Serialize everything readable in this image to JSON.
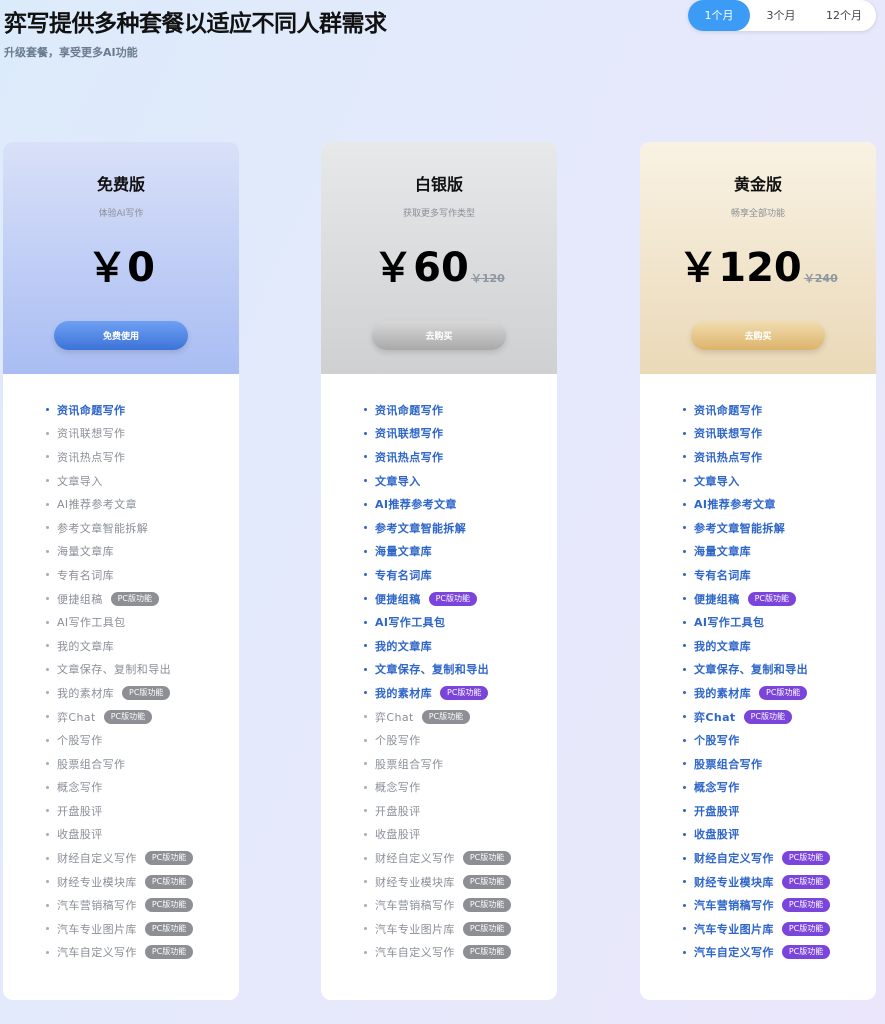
{
  "header": {
    "title": "弈写提供多种套餐以适应不同人群需求",
    "subtitle": "升级套餐，享受更多AI功能"
  },
  "period_tabs": [
    {
      "label": "1个月",
      "active": true
    },
    {
      "label": "3个月",
      "active": false
    },
    {
      "label": "12个月",
      "active": false
    }
  ],
  "badge_label": "PC版功能",
  "plans": [
    {
      "name": "免费版",
      "desc": "体验AI写作",
      "price": "￥0",
      "old_price": "",
      "button": "免费使用"
    },
    {
      "name": "白银版",
      "desc": "获取更多写作类型",
      "price": "￥60",
      "old_price": "￥120",
      "button": "去购买"
    },
    {
      "name": "黄金版",
      "desc": "畅享全部功能",
      "price": "￥120",
      "old_price": "￥240",
      "button": "去购买"
    }
  ],
  "features": [
    {
      "label": "资讯命题写作",
      "pc": false
    },
    {
      "label": "资讯联想写作",
      "pc": false
    },
    {
      "label": "资讯热点写作",
      "pc": false
    },
    {
      "label": "文章导入",
      "pc": false
    },
    {
      "label": "AI推荐参考文章",
      "pc": false
    },
    {
      "label": "参考文章智能拆解",
      "pc": false
    },
    {
      "label": "海量文章库",
      "pc": false
    },
    {
      "label": "专有名词库",
      "pc": false
    },
    {
      "label": "便捷组稿",
      "pc": true
    },
    {
      "label": "AI写作工具包",
      "pc": false
    },
    {
      "label": "我的文章库",
      "pc": false
    },
    {
      "label": "文章保存、复制和导出",
      "pc": false
    },
    {
      "label": "我的素材库",
      "pc": true
    },
    {
      "label": "弈Chat",
      "pc": true
    },
    {
      "label": "个股写作",
      "pc": false
    },
    {
      "label": "股票组合写作",
      "pc": false
    },
    {
      "label": "概念写作",
      "pc": false
    },
    {
      "label": "开盘股评",
      "pc": false
    },
    {
      "label": "收盘股评",
      "pc": false
    },
    {
      "label": "财经自定义写作",
      "pc": true
    },
    {
      "label": "财经专业模块库",
      "pc": true
    },
    {
      "label": "汽车营销稿写作",
      "pc": true
    },
    {
      "label": "汽车专业图片库",
      "pc": true
    },
    {
      "label": "汽车自定义写作",
      "pc": true
    }
  ],
  "enabled_counts": [
    1,
    13,
    24
  ],
  "colors": {
    "accent": "#3c9bf4",
    "enabled_text": "#2f66c9",
    "disabled_text": "#8a8f98",
    "badge_enabled": "#7b45dc",
    "badge_disabled": "#8d8f94"
  }
}
